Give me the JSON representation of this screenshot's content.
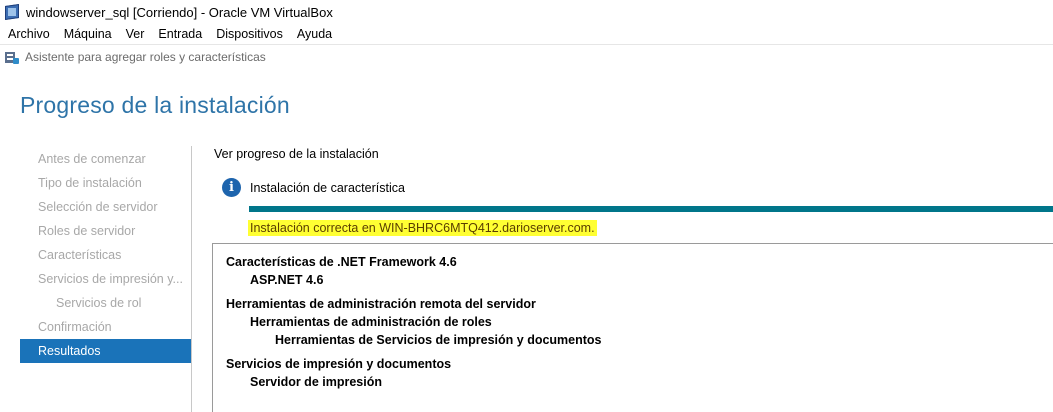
{
  "window": {
    "title": "windowserver_sql [Corriendo] - Oracle VM VirtualBox",
    "icon": "virtualbox-icon"
  },
  "menubar": {
    "items": [
      "Archivo",
      "Máquina",
      "Ver",
      "Entrada",
      "Dispositivos",
      "Ayuda"
    ]
  },
  "wizard": {
    "title": "Asistente para agregar roles y características",
    "icon": "server-wizard-icon"
  },
  "page": {
    "title": "Progreso de la instalación"
  },
  "nav": {
    "items": [
      {
        "label": "Antes de comenzar",
        "level": 0,
        "active": false
      },
      {
        "label": "Tipo de instalación",
        "level": 0,
        "active": false
      },
      {
        "label": "Selección de servidor",
        "level": 0,
        "active": false
      },
      {
        "label": "Roles de servidor",
        "level": 0,
        "active": false
      },
      {
        "label": "Características",
        "level": 0,
        "active": false
      },
      {
        "label": "Servicios de impresión y...",
        "level": 0,
        "active": false
      },
      {
        "label": "Servicios de rol",
        "level": 1,
        "active": false
      },
      {
        "label": "Confirmación",
        "level": 0,
        "active": false
      },
      {
        "label": "Resultados",
        "level": 0,
        "active": true
      }
    ]
  },
  "main": {
    "progress_label": "Ver progreso de la instalación",
    "status_text": "Instalación de característica",
    "status_icon": "info-icon",
    "progress": 1.0,
    "progress_color": "#00768a",
    "success_message": "Instalación correcta en WIN-BHRC6MTQ412.darioserver.com.",
    "highlight_color": "#ffff33"
  },
  "results": [
    {
      "text": "Características de .NET Framework 4.6",
      "level": 0
    },
    {
      "text": "ASP.NET 4.6",
      "level": 1
    },
    {
      "gap": true
    },
    {
      "text": "Herramientas de administración remota del servidor",
      "level": 0
    },
    {
      "text": "Herramientas de administración de roles",
      "level": 1
    },
    {
      "text": "Herramientas de Servicios de impresión y documentos",
      "level": 2
    },
    {
      "gap": true
    },
    {
      "text": "Servicios de impresión y documentos",
      "level": 0
    },
    {
      "text": "Servidor de impresión",
      "level": 1
    }
  ]
}
